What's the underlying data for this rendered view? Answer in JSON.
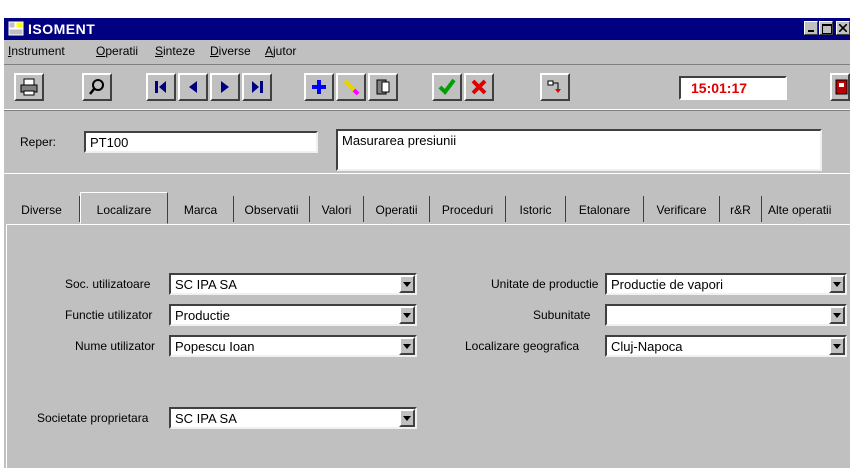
{
  "window": {
    "title": "ISOMENT"
  },
  "menu": [
    "Instrument",
    "Operatii",
    "Sinteze",
    "Diverse",
    "Ajutor"
  ],
  "toolbar": {
    "buttons": [
      "print-icon",
      "search-icon",
      "first-record-icon",
      "previous-record-icon",
      "next-record-icon",
      "last-record-icon",
      "add-icon",
      "edit-icon",
      "delete-icon",
      "confirm-icon",
      "cancel-icon",
      "transfer-icon",
      "exit-icon"
    ],
    "time": "15:01:17"
  },
  "header": {
    "reper_label": "Reper:",
    "reper_value": "PT100",
    "description": "Masurarea presiunii"
  },
  "tabs": [
    "Diverse",
    "Localizare",
    "Marca",
    "Observatii",
    "Valori",
    "Operatii",
    "Proceduri",
    "Istoric",
    "Etalonare",
    "Verificare",
    "r&R",
    "Alte operatii"
  ],
  "active_tab": "Localizare",
  "form": {
    "soc_utilizatoare": {
      "label": "Soc. utilizatoare",
      "value": "SC IPA SA"
    },
    "functie_utilizator": {
      "label": "Functie utilizator",
      "value": "Productie"
    },
    "nume_utilizator": {
      "label": "Nume utilizator",
      "value": "Popescu Ioan"
    },
    "societate_proprietara": {
      "label": "Societate proprietara",
      "value": "SC IPA SA"
    },
    "unitate_productie": {
      "label": "Unitate de productie",
      "value": "Productie de vapori"
    },
    "subunitate": {
      "label": "Subunitate",
      "value": ""
    },
    "localizare_geografica": {
      "label": "Localizare geografica",
      "value": "Cluj-Napoca"
    }
  },
  "colors": {
    "titlebar": "#000080",
    "clock_text": "#e00000",
    "face": "#c0c0c0"
  }
}
